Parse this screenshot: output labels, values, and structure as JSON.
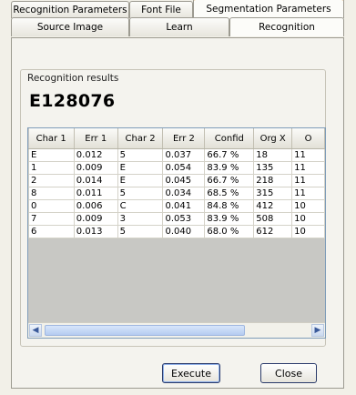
{
  "tabs_row1": [
    {
      "label": "Recognition Parameters"
    },
    {
      "label": "Font File"
    },
    {
      "label": "Segmentation Parameters"
    }
  ],
  "tabs_row2": [
    {
      "label": "Source Image"
    },
    {
      "label": "Learn"
    },
    {
      "label": "Recognition"
    }
  ],
  "active_tab": "Recognition",
  "results": {
    "group_title": "Recognition results",
    "value": "E128076"
  },
  "grid": {
    "columns": [
      "Char 1",
      "Err 1",
      "Char 2",
      "Err 2",
      "Confid",
      "Org X",
      "O"
    ],
    "rows": [
      [
        "E",
        "0.012",
        "5",
        "0.037",
        "66.7 %",
        "18",
        "11"
      ],
      [
        "1",
        "0.009",
        "E",
        "0.054",
        "83.9 %",
        "135",
        "11"
      ],
      [
        "2",
        "0.014",
        "E",
        "0.045",
        "66.7 %",
        "218",
        "11"
      ],
      [
        "8",
        "0.011",
        "5",
        "0.034",
        "68.5 %",
        "315",
        "11"
      ],
      [
        "0",
        "0.006",
        "C",
        "0.041",
        "84.8 %",
        "412",
        "10"
      ],
      [
        "7",
        "0.009",
        "3",
        "0.053",
        "83.9 %",
        "508",
        "10"
      ],
      [
        "6",
        "0.013",
        "5",
        "0.040",
        "68.0 %",
        "612",
        "10"
      ]
    ]
  },
  "scrollbar": {
    "left_arrow": "◀",
    "right_arrow": "▶"
  },
  "buttons": {
    "execute": "Execute",
    "close": "Close"
  },
  "colors": {
    "active_tab_accent": "#f0a33e",
    "window_bg": "#f2f0e8",
    "grid_empty": "#c8c8c4"
  }
}
